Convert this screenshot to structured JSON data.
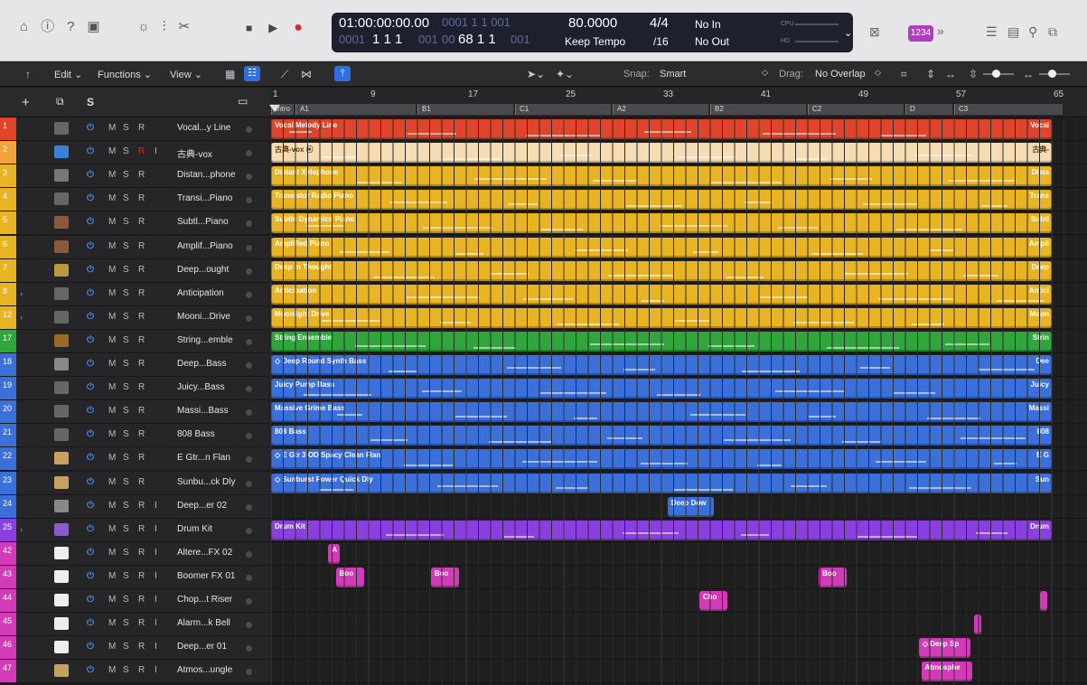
{
  "toolbar": {
    "left_icons": [
      "inbox-icon",
      "info-icon",
      "help-icon",
      "editors-icon",
      "brightness-icon",
      "mixer-icon",
      "scissors-icon"
    ],
    "transport": {
      "stop": "■",
      "play": "▶",
      "record": "●"
    }
  },
  "lcd": {
    "time": "01:00:00:00.00",
    "time_ghost": "0001 1 1 001",
    "bars": "1 1 1",
    "bars_ghost_pre": "0001",
    "bars_ghost_post": "001",
    "bars2": "68 1 1",
    "bars2_ghost_pre": "00",
    "bars2_ghost_post": "001",
    "tempo": "80.0000",
    "tempo_mode": "Keep Tempo",
    "signature": "4/4",
    "division": "/16",
    "midi_in": "No In",
    "midi_out": "No Out",
    "cpu_label": "CPU",
    "hd_label": "HD"
  },
  "toolbar_right": {
    "badge": "1234",
    "more": "»"
  },
  "menubar": {
    "edit": "Edit",
    "functions": "Functions",
    "view": "View",
    "snap_label": "Snap:",
    "snap_value": "Smart",
    "drag_label": "Drag:",
    "drag_value": "No Overlap"
  },
  "header": {
    "add": "+",
    "solo": "S"
  },
  "ruler": {
    "bars": [
      "1",
      "9",
      "17",
      "25",
      "33",
      "41",
      "49",
      "57",
      "65"
    ],
    "markers": [
      "Intro",
      "A1",
      "B1",
      "C1",
      "A2",
      "B2",
      "C2",
      "D",
      "C3"
    ]
  },
  "tracks": [
    {
      "num": "1",
      "name": "Vocal...y Line",
      "color": "#e0442a",
      "ic": "#666",
      "rec": false,
      "inp": false
    },
    {
      "num": "2",
      "name": "古典-vox",
      "color": "#f2a33a",
      "ic": "#3b7fd9",
      "rec": true,
      "inp": true
    },
    {
      "num": "3",
      "name": "Distan...phone",
      "color": "#e8b424",
      "ic": "#777",
      "rec": false,
      "inp": false
    },
    {
      "num": "4",
      "name": "Transi...Piano",
      "color": "#e8b424",
      "ic": "#666",
      "rec": false,
      "inp": false
    },
    {
      "num": "5",
      "name": "Subtl...Piano",
      "color": "#e8b424",
      "ic": "#8a5a3a",
      "rec": false,
      "inp": false
    },
    {
      "num": "6",
      "name": "Amplif...Piano",
      "color": "#e8b424",
      "ic": "#8a5a3a",
      "rec": false,
      "inp": false
    },
    {
      "num": "7",
      "name": "Deep...ought",
      "color": "#e8b424",
      "ic": "#b89a3a",
      "rec": false,
      "inp": false
    },
    {
      "num": "8",
      "name": "Anticipation",
      "color": "#e8b424",
      "ic": "#666",
      "rec": false,
      "inp": false,
      "disc": true
    },
    {
      "num": "12",
      "name": "Mooni...Drive",
      "color": "#e8b424",
      "ic": "#666",
      "rec": false,
      "inp": false,
      "disc": true
    },
    {
      "num": "17",
      "name": "String...emble",
      "color": "#2fa53c",
      "ic": "#9a6a2a",
      "rec": false,
      "inp": false
    },
    {
      "num": "18",
      "name": "Deep...Bass",
      "color": "#3b6fd9",
      "ic": "#888",
      "rec": false,
      "inp": false
    },
    {
      "num": "19",
      "name": "Juicy...Bass",
      "color": "#3b6fd9",
      "ic": "#666",
      "rec": false,
      "inp": false
    },
    {
      "num": "20",
      "name": "Massi...Bass",
      "color": "#3b6fd9",
      "ic": "#666",
      "rec": false,
      "inp": false
    },
    {
      "num": "21",
      "name": "808 Bass",
      "color": "#3b6fd9",
      "ic": "#666",
      "rec": false,
      "inp": false
    },
    {
      "num": "22",
      "name": "E Gtr...n Flan",
      "color": "#3b6fd9",
      "ic": "#c8a060",
      "rec": false,
      "inp": false
    },
    {
      "num": "23",
      "name": "Sunbu...ck Dly",
      "color": "#3b6fd9",
      "ic": "#c8a060",
      "rec": false,
      "inp": false
    },
    {
      "num": "24",
      "name": "Deep...er 02",
      "color": "#3b6fd9",
      "ic": "#888",
      "rec": false,
      "inp": true
    },
    {
      "num": "25",
      "name": "Drum Kit",
      "color": "#8a3fe0",
      "ic": "#8a5ad0",
      "rec": false,
      "inp": true,
      "disc": true
    },
    {
      "num": "42",
      "name": "Altere...FX 02",
      "color": "#d33ab8",
      "ic": "#eee",
      "rec": false,
      "inp": true
    },
    {
      "num": "43",
      "name": "Boomer FX 01",
      "color": "#d33ab8",
      "ic": "#eee",
      "rec": false,
      "inp": true
    },
    {
      "num": "44",
      "name": "Chop...t Riser",
      "color": "#d33ab8",
      "ic": "#eee",
      "rec": false,
      "inp": true
    },
    {
      "num": "45",
      "name": "Alarm...k Bell",
      "color": "#d33ab8",
      "ic": "#eee",
      "rec": false,
      "inp": true
    },
    {
      "num": "46",
      "name": "Deep...er 01",
      "color": "#d33ab8",
      "ic": "#eee",
      "rec": false,
      "inp": true
    },
    {
      "num": "47",
      "name": "Atmos...ungle",
      "color": "#d33ab8",
      "ic": "#c8a060",
      "rec": false,
      "inp": true
    }
  ],
  "track_buttons": {
    "power": "⏻",
    "mute": "M",
    "solo": "S",
    "record": "R",
    "input": "I"
  },
  "regions": [
    {
      "track": 0,
      "start": 1,
      "end": 65,
      "label": "Vocal Melody Line",
      "tail": "Vocal",
      "color": "#e0442a"
    },
    {
      "track": 1,
      "start": 1,
      "end": 65,
      "label": "古典-vox ⦿",
      "tail": "古典-",
      "color": "#f6dcb4",
      "dark": true
    },
    {
      "track": 2,
      "start": 1,
      "end": 65,
      "label": "Distant Xylophone",
      "tail": "Dista",
      "color": "#e8b424"
    },
    {
      "track": 3,
      "start": 1,
      "end": 65,
      "label": "Transistor Radio Piano",
      "tail": "Trans",
      "color": "#e8b424"
    },
    {
      "track": 4,
      "start": 1,
      "end": 65,
      "label": "Subtle Dynamics Piano",
      "tail": "Subtl",
      "color": "#e8b424"
    },
    {
      "track": 5,
      "start": 1,
      "end": 65,
      "label": "Amplified Piano",
      "tail": "Ampli",
      "color": "#e8b424"
    },
    {
      "track": 6,
      "start": 1,
      "end": 65,
      "label": "Deep In Thought",
      "tail": "Deep",
      "color": "#e8b424"
    },
    {
      "track": 7,
      "start": 1,
      "end": 65,
      "label": "Anticipation",
      "tail": "Antici",
      "color": "#e8b424"
    },
    {
      "track": 8,
      "start": 1,
      "end": 65,
      "label": "Moonlight Drive",
      "tail": "Moon",
      "color": "#e8b424"
    },
    {
      "track": 9,
      "start": 1,
      "end": 65,
      "label": "String Ensemble",
      "tail": "Strin",
      "color": "#2fa53c"
    },
    {
      "track": 10,
      "start": 1,
      "end": 65,
      "label": "◇ Deep Round Synth Bass",
      "tail": "Dee",
      "color": "#3b6fd9"
    },
    {
      "track": 11,
      "start": 1,
      "end": 65,
      "label": "Juicy Pump Bass",
      "tail": "Juicy",
      "color": "#3b6fd9"
    },
    {
      "track": 12,
      "start": 1,
      "end": 65,
      "label": "Massive Grime Bass",
      "tail": "Massi",
      "color": "#3b6fd9"
    },
    {
      "track": 13,
      "start": 1,
      "end": 65,
      "label": "808 Bass",
      "tail": "808",
      "color": "#3b6fd9"
    },
    {
      "track": 14,
      "start": 1,
      "end": 65,
      "label": "◇ E Gtr 3 OD Spacy Clean Flan",
      "tail": "E G",
      "color": "#3b6fd9"
    },
    {
      "track": 15,
      "start": 1,
      "end": 65,
      "label": "◇ Sunburst Power Quick Dly",
      "tail": "Sun",
      "color": "#3b6fd9"
    },
    {
      "track": 16,
      "start": 33.5,
      "end": 37.3,
      "label": "Deep Dow",
      "tail": "",
      "color": "#3b6fd9"
    },
    {
      "track": 17,
      "start": 1,
      "end": 65,
      "label": "Drum Kit",
      "tail": "Drum",
      "color": "#8a3fe0"
    },
    {
      "track": 18,
      "start": 5.7,
      "end": 6.6,
      "label": "A",
      "tail": "",
      "color": "#d33ab8"
    },
    {
      "track": 19,
      "start": 6.3,
      "end": 8.6,
      "label": "Boo",
      "tail": "",
      "color": "#d33ab8"
    },
    {
      "track": 19,
      "start": 14.1,
      "end": 16.4,
      "label": "Boo",
      "tail": "",
      "color": "#d33ab8"
    },
    {
      "track": 19,
      "start": 45.9,
      "end": 48.2,
      "label": "Boo",
      "tail": "",
      "color": "#d33ab8"
    },
    {
      "track": 20,
      "start": 36.1,
      "end": 38.4,
      "label": "Cho",
      "tail": "",
      "color": "#d33ab8"
    },
    {
      "track": 20,
      "start": 64.0,
      "end": 64.6,
      "label": "",
      "tail": "",
      "color": "#d33ab8"
    },
    {
      "track": 21,
      "start": 58.6,
      "end": 59.2,
      "label": "",
      "tail": "",
      "color": "#d33ab8"
    },
    {
      "track": 22,
      "start": 54.1,
      "end": 58.3,
      "label": "◇ Deep Sp",
      "tail": "",
      "color": "#d33ab8"
    },
    {
      "track": 23,
      "start": 54.3,
      "end": 58.5,
      "label": "Atmosphe",
      "tail": "",
      "color": "#d33ab8"
    }
  ]
}
